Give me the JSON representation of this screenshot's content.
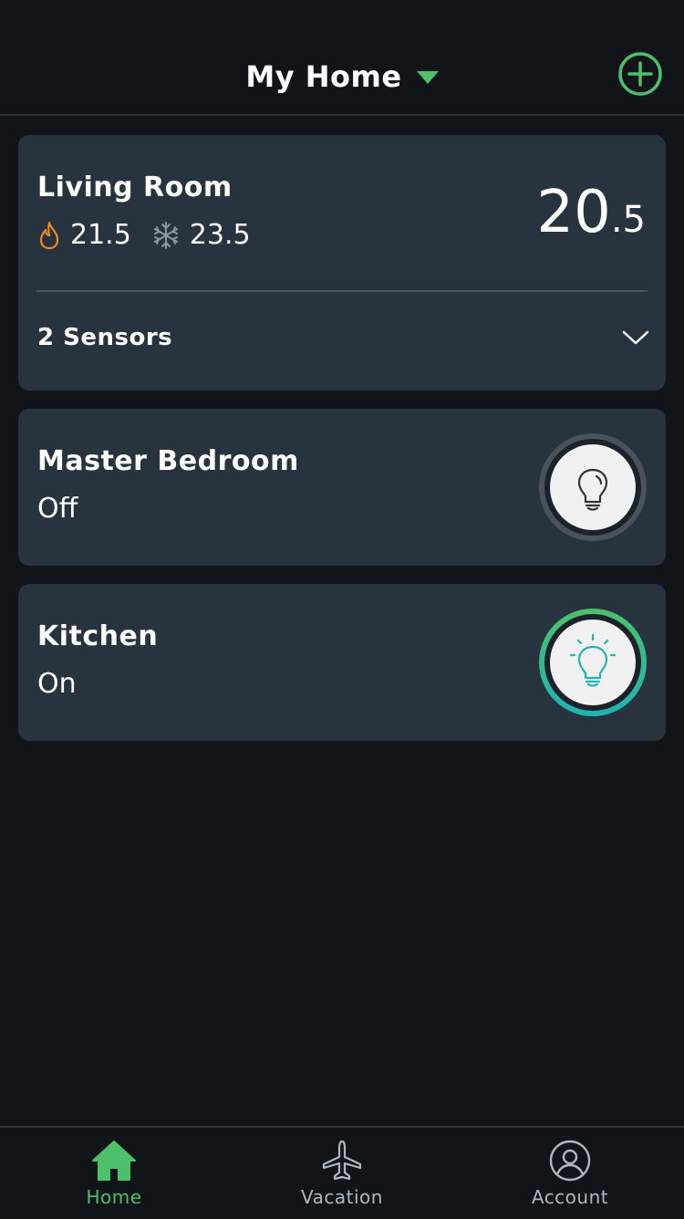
{
  "header": {
    "home_name": "My Home"
  },
  "rooms": {
    "living": {
      "name": "Living Room",
      "heat_setpoint": "21.5",
      "cool_setpoint": "23.5",
      "temp_whole": "20",
      "temp_decimal": ".5",
      "sensors_label": "2 Sensors"
    },
    "master": {
      "name": "Master Bedroom",
      "status": "Off"
    },
    "kitchen": {
      "name": "Kitchen",
      "status": "On"
    }
  },
  "tabs": [
    {
      "label": "Home",
      "icon": "home-icon",
      "active": true
    },
    {
      "label": "Vacation",
      "icon": "airplane-icon",
      "active": false
    },
    {
      "label": "Account",
      "icon": "account-icon",
      "active": false
    }
  ],
  "colors": {
    "background": "#11151a",
    "card": "#283340",
    "accent_green": "#4cc06a",
    "heat_orange": "#e98a2a",
    "light_on_teal": "#25b4b0"
  }
}
